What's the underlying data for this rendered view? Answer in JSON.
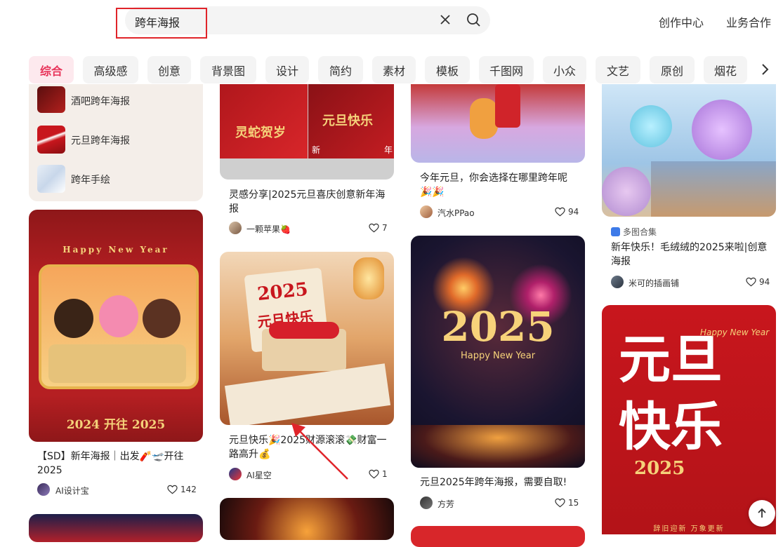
{
  "search": {
    "query": "跨年海报"
  },
  "top_links": {
    "creation_center": "创作中心",
    "business": "业务合作"
  },
  "tags": [
    "综合",
    "高级感",
    "创意",
    "背景图",
    "设计",
    "简约",
    "素材",
    "模板",
    "千图网",
    "小众",
    "文艺",
    "原创",
    "烟花"
  ],
  "related_panel": {
    "items": [
      {
        "label": "酒吧跨年海报"
      },
      {
        "label": "元旦跨年海报"
      },
      {
        "label": "跨年手绘"
      }
    ]
  },
  "cards": {
    "c1": {
      "title": "【SD】新年海报｜出发🧨🛫开往 2025",
      "author": "AI设计宝",
      "likes": "142",
      "poster_line": "Happy New Year",
      "poster_years": "2024 开往 2025"
    },
    "c2": {
      "title": "灵感分享|2025元旦喜庆创意新年海报",
      "author": "一颗苹果🍓",
      "likes": "7",
      "poster_a": "灵蛇贺岁",
      "poster_b": "元旦快乐",
      "poster_c1": "新",
      "poster_c2": "年"
    },
    "c3": {
      "title": "元旦快乐🎉2025财源滚滚💸财富一路高升💰",
      "author": "AI星空",
      "likes": "1",
      "poster_year": "2025",
      "poster_text": "元旦快乐"
    },
    "c4": {
      "title": "今年元旦，你会选择在哪里跨年呢🎉🎉",
      "author": "汽水PPao",
      "likes": "94"
    },
    "c5": {
      "title": "元旦2025年跨年海报，需要自取!",
      "author": "方芳",
      "likes": "15",
      "poster_year": "2025",
      "poster_sub": "Happy New Year"
    },
    "c6": {
      "badge": "多图合集",
      "title": "新年快乐！毛绒绒的2025来啦|创意海报",
      "author": "米可的插画铺",
      "likes": "94"
    },
    "c7": {
      "poster_text": "元旦快乐",
      "poster_sub": "Happy New Year",
      "poster_year": "2025",
      "poster_foot": "辞旧迎新 万象更新"
    }
  },
  "colors": {
    "accent": "#e8345a",
    "annotation": "#e0242a",
    "poster_red": "#c8161d"
  }
}
